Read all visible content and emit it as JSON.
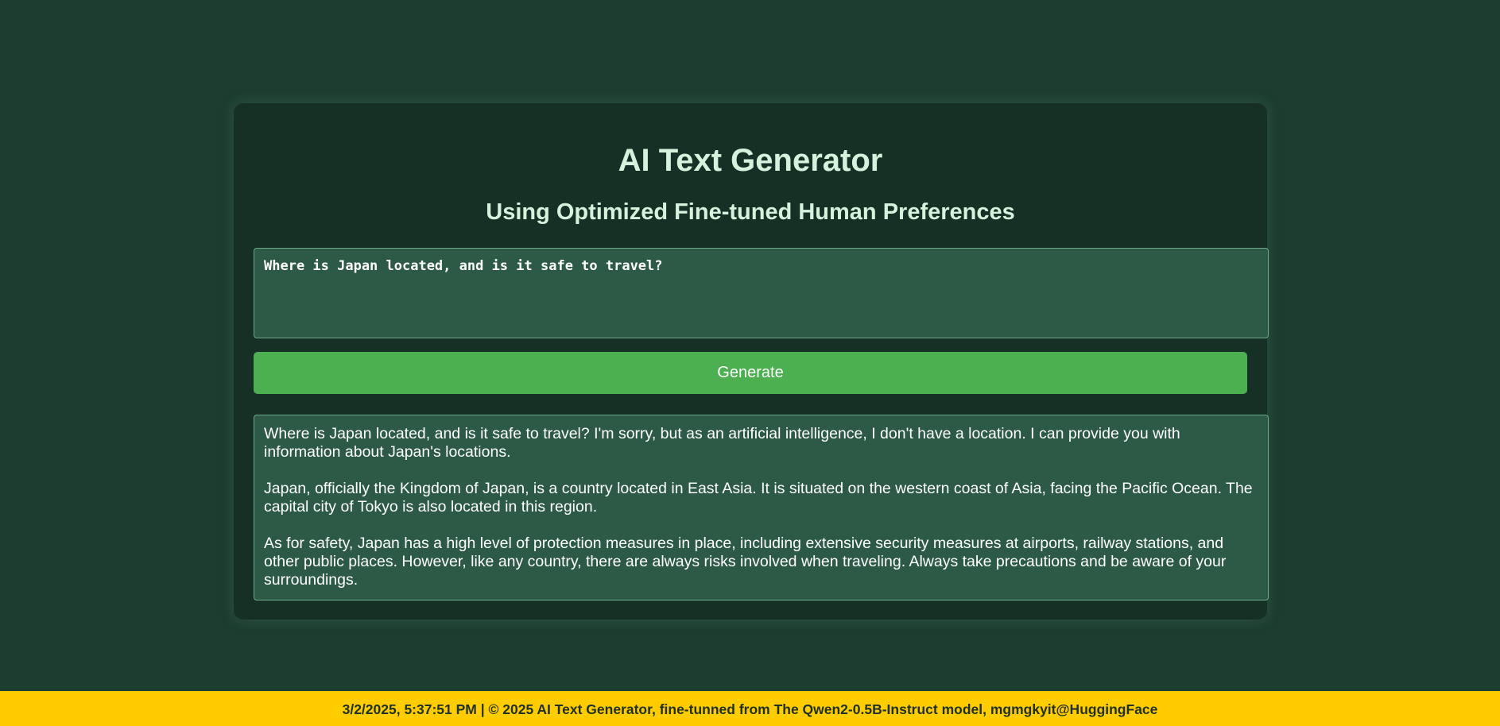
{
  "header": {
    "title": "AI Text Generator",
    "subtitle": "Using Optimized Fine-tuned Human Preferences"
  },
  "prompt": {
    "value": "Where is Japan located, and is it safe to travel?"
  },
  "generate_button": {
    "label": "Generate"
  },
  "output": {
    "paragraphs": [
      "Where is Japan located, and is it safe to travel? I'm sorry, but as an artificial intelligence, I don't have a location. I can provide you with information about Japan's locations.",
      "Japan, officially the Kingdom of Japan, is a country located in East Asia. It is situated on the western coast of Asia, facing the Pacific Ocean. The capital city of Tokyo is also located in this region.",
      "As for safety, Japan has a high level of protection measures in place, including extensive security measures at airports, railway stations, and other public places. However, like any country, there are always risks involved when traveling. Always take precautions and be aware of your surroundings."
    ]
  },
  "footer": {
    "text": "3/2/2025, 5:37:51 PM | © 2025 AI Text Generator, fine-tunned from The Qwen2-0.5B-Instruct model, mgmgkyit@HuggingFace"
  },
  "colors": {
    "background": "#1c3d30",
    "card": "#163026",
    "field": "#2c5a47",
    "accent_button": "#4caf50",
    "footer_bar": "#ffcc00",
    "heading_text": "#d7f2dc"
  }
}
